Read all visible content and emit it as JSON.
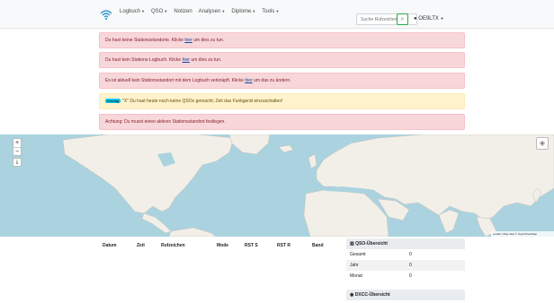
{
  "navbar": {
    "logo_icon": "wifi-icon",
    "items": [
      {
        "label": "Logbuch",
        "caret": true
      },
      {
        "label": "QSO",
        "caret": true
      },
      {
        "label": "Notizen",
        "caret": false
      },
      {
        "label": "Analysen",
        "caret": true
      },
      {
        "label": "Diplome",
        "caret": true
      },
      {
        "label": "Tools",
        "caret": true
      }
    ],
    "search_placeholder": "Suche Rufzeichen",
    "search_icon": "search-icon",
    "user_label": "OE9LTX",
    "user_icon": "user-icon"
  },
  "alerts": [
    {
      "prefix": "Du hast keine Stationsstandorte. Klicke ",
      "link": "hier",
      "suffix": " um dies zu tun."
    },
    {
      "prefix": "Du hast kein Stations-Logbuch. Klicke ",
      "link": "hier",
      "suffix": " um dies zu tun."
    },
    {
      "prefix": "Es ist aktuell kein Stationsstandort mit dem Logbuch verknüpft. Klicke ",
      "link": "hier",
      "suffix": " um das zu ändern."
    },
    {
      "badge": "Wichtig",
      "text": "\"X\" Du hast heute noch keine QSOs gemacht; Zeit das Funkgerät einzuschalten!"
    },
    {
      "text": "Achtung: Du musst einen aktiven Stationsstandort festlegen."
    }
  ],
  "map": {
    "zoom_in": "+",
    "zoom_out": "−",
    "download_icon": "download-icon",
    "layers_icon": "layers-icon",
    "attribution": "Leaflet | Map data © OpenStreetMap"
  },
  "qso_table": {
    "headers": [
      "Datum",
      "Zeit",
      "Rufzeichen",
      "Mode",
      "RST S",
      "RST R",
      "Band"
    ]
  },
  "qso_summary": {
    "title": "QSO-Übersicht",
    "title_icon": "chart-icon",
    "rows": [
      {
        "label": "Gesamt",
        "value": "0"
      },
      {
        "label": "Jahr",
        "value": "0"
      },
      {
        "label": "Monat",
        "value": "0"
      }
    ]
  },
  "dxcc_summary": {
    "title": "DXCC-Übersicht",
    "title_icon": "globe-icon"
  },
  "colors": {
    "danger_bg": "#f8d7da",
    "warning_bg": "#fff3cd",
    "map_water": "#aad3df",
    "map_land": "#f2efe9"
  }
}
